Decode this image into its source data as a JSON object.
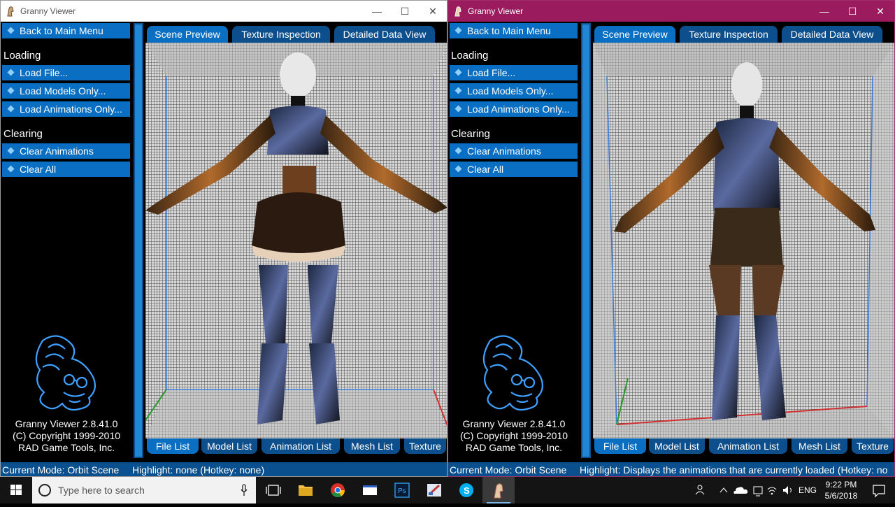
{
  "window_title": "Granny Viewer",
  "sidebar": {
    "back": "Back to Main Menu",
    "loading_header": "Loading",
    "loading_items": [
      "Load File...",
      "Load Models Only...",
      "Load Animations Only..."
    ],
    "clearing_header": "Clearing",
    "clearing_items": [
      "Clear Animations",
      "Clear All"
    ],
    "credits": [
      "Granny Viewer 2.8.41.0",
      "(C) Copyright 1999-2010",
      "RAD Game Tools, Inc."
    ]
  },
  "top_tabs": [
    "Scene Preview",
    "Texture Inspection",
    "Detailed Data View"
  ],
  "bottom_tabs": [
    "File List",
    "Model List",
    "Animation List",
    "Mesh List",
    "Texture"
  ],
  "left_window": {
    "status_mode": "Current Mode: Orbit Scene",
    "status_highlight": "Highlight: none (Hotkey: none)"
  },
  "right_window": {
    "status_mode": "Current Mode: Orbit Scene",
    "status_highlight": "Highlight: Displays the animations that are currently loaded (Hotkey: no"
  },
  "taskbar": {
    "search_placeholder": "Type here to search",
    "language": "ENG",
    "time": "9:22 PM",
    "date": "5/6/2018"
  },
  "colors": {
    "accent_blue": "#0a6fc2",
    "dark_blue": "#0c4f8c",
    "right_titlebar": "#9b1b5f"
  }
}
